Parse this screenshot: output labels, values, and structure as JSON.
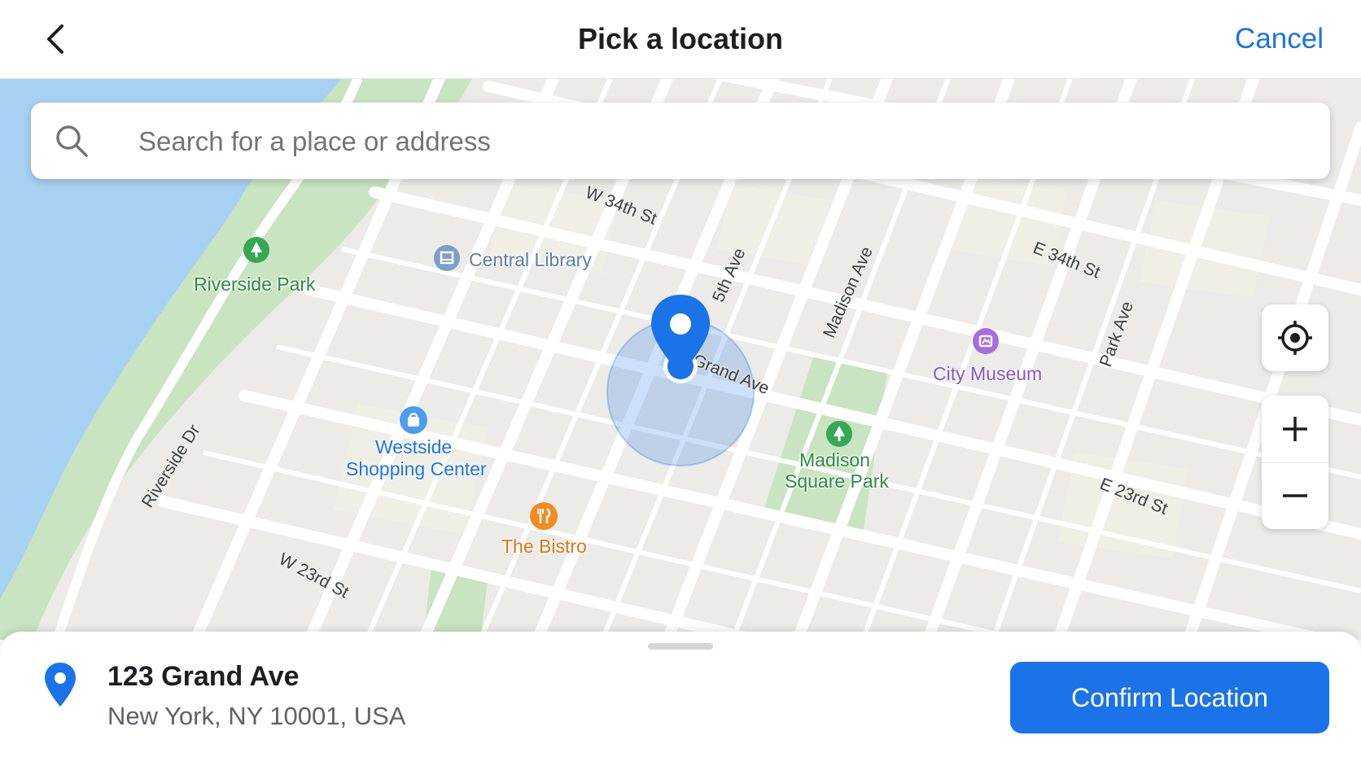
{
  "header": {
    "title": "Pick a location",
    "cancel_label": "Cancel"
  },
  "search": {
    "placeholder": "Search for a place or address",
    "value": ""
  },
  "map": {
    "streets": {
      "w34": "W 34th St",
      "e34": "E 34th St",
      "fifth": "5th Ave",
      "madison": "Madison Ave",
      "park": "Park Ave",
      "riverside": "Riverside Dr",
      "w23": "W 23rd St",
      "e23": "E 23rd St",
      "grand": "Grand Ave"
    },
    "pois": {
      "riverside_park": "Riverside Park",
      "central_library": "Central Library",
      "city_museum": "City Museum",
      "westside_line1": "Westside",
      "westside_line2": "Shopping Center",
      "madison_line1": "Madison",
      "madison_line2": "Square Park",
      "bistro": "The Bistro"
    },
    "controls": {
      "locate_icon": "crosshair-icon",
      "zoom_in_icon": "plus-icon",
      "zoom_out_icon": "minus-icon"
    },
    "colors": {
      "water": "#a7d1f2",
      "park": "#c9e4c0",
      "pin": "#1a73e8",
      "poi_green": "#34a853",
      "poi_blue": "#4285f4",
      "poi_purple": "#a66ce0",
      "poi_orange": "#f28b22"
    }
  },
  "sheet": {
    "address_title": "123 Grand Ave",
    "address_subtitle": "New York, NY 10001, USA",
    "confirm_label": "Confirm Location"
  }
}
